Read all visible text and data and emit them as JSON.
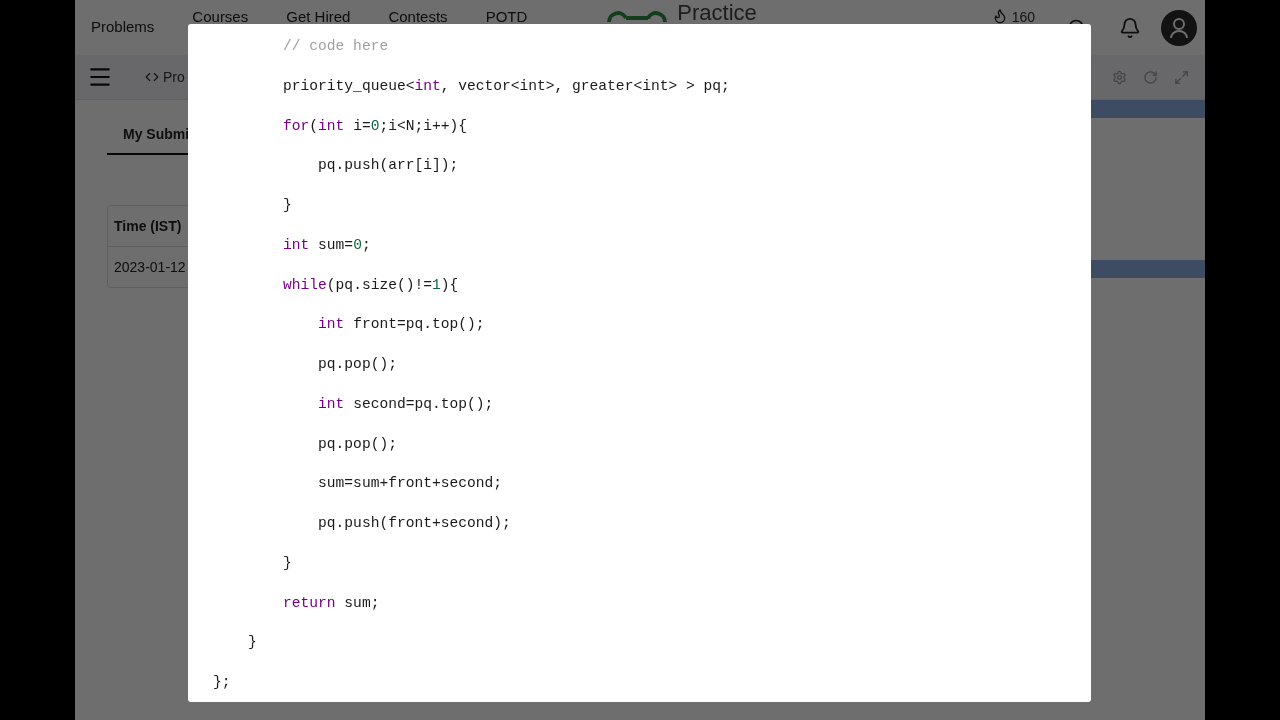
{
  "header": {
    "nav": [
      "Problems",
      "Courses",
      "Get Hired",
      "Contests",
      "POTD"
    ],
    "logo": "Practice",
    "streak": "160"
  },
  "toolbar": {
    "tab": "Pro"
  },
  "submissions": {
    "tab": "My Submi",
    "column": "Time (IST)",
    "cell": "2023-01-12"
  },
  "code_modal": {
    "lines": [
      {
        "segments": [
          {
            "kind": "comment",
            "text": "        // code here"
          }
        ]
      },
      {
        "segments": [
          {
            "kind": "plain",
            "text": "        priority_queue<"
          },
          {
            "kind": "keyword",
            "text": "int"
          },
          {
            "kind": "plain",
            "text": ", vector<int>, greater<int> > pq;"
          }
        ]
      },
      {
        "segments": [
          {
            "kind": "keyword",
            "text": "        for"
          },
          {
            "kind": "plain",
            "text": "("
          },
          {
            "kind": "keyword",
            "text": "int"
          },
          {
            "kind": "plain",
            "text": " i="
          },
          {
            "kind": "number",
            "text": "0"
          },
          {
            "kind": "plain",
            "text": ";i<N;i++){"
          }
        ]
      },
      {
        "segments": [
          {
            "kind": "plain",
            "text": "            pq.push(arr[i]);"
          }
        ]
      },
      {
        "segments": [
          {
            "kind": "plain",
            "text": "        }"
          }
        ]
      },
      {
        "segments": [
          {
            "kind": "keyword",
            "text": "        int"
          },
          {
            "kind": "plain",
            "text": " sum="
          },
          {
            "kind": "number",
            "text": "0"
          },
          {
            "kind": "plain",
            "text": ";"
          }
        ]
      },
      {
        "segments": [
          {
            "kind": "keyword",
            "text": "        while"
          },
          {
            "kind": "plain",
            "text": "(pq.size()!="
          },
          {
            "kind": "number",
            "text": "1"
          },
          {
            "kind": "plain",
            "text": "){"
          }
        ]
      },
      {
        "segments": [
          {
            "kind": "keyword",
            "text": "            int"
          },
          {
            "kind": "plain",
            "text": " front=pq.top();"
          }
        ]
      },
      {
        "segments": [
          {
            "kind": "plain",
            "text": "            pq.pop();"
          }
        ]
      },
      {
        "segments": [
          {
            "kind": "keyword",
            "text": "            int"
          },
          {
            "kind": "plain",
            "text": " second=pq.top();"
          }
        ]
      },
      {
        "segments": [
          {
            "kind": "plain",
            "text": "            pq.pop();"
          }
        ]
      },
      {
        "segments": [
          {
            "kind": "plain",
            "text": "            sum=sum+front+second;"
          }
        ]
      },
      {
        "segments": [
          {
            "kind": "plain",
            "text": "            pq.push(front+second);"
          }
        ]
      },
      {
        "segments": [
          {
            "kind": "plain",
            "text": "        }"
          }
        ]
      },
      {
        "segments": [
          {
            "kind": "keyword",
            "text": "        return"
          },
          {
            "kind": "plain",
            "text": " sum;"
          }
        ]
      },
      {
        "segments": [
          {
            "kind": "plain",
            "text": "    }"
          }
        ]
      },
      {
        "segments": [
          {
            "kind": "plain",
            "text": "};"
          }
        ]
      }
    ]
  }
}
